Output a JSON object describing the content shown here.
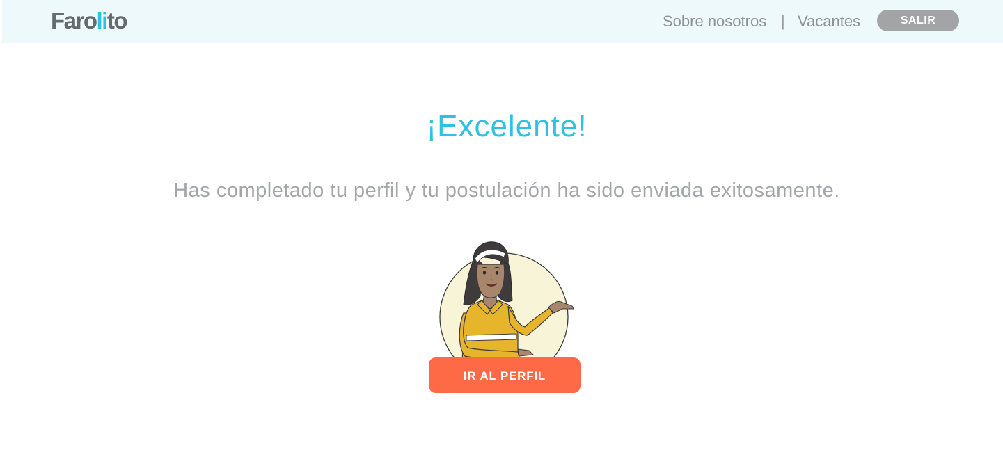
{
  "header": {
    "logo": {
      "part1": "Faro",
      "part2": "li",
      "part3": "to"
    },
    "nav": {
      "about": "Sobre nosotros",
      "separator": "|",
      "jobs": "Vacantes"
    },
    "logout_label": "SALIR"
  },
  "main": {
    "title": "¡Excelente!",
    "message": "Has completado tu perfil y tu postulación ha sido enviada exitosamente.",
    "illustration": "woman-presenting-illustration",
    "cta_label": "IR AL PERFIL"
  },
  "colors": {
    "header_bg": "#edf9fb",
    "accent": "#2fc1e3",
    "cta": "#ff6a46",
    "logout": "#a2a4a6",
    "text_muted": "#a3a5a8"
  }
}
